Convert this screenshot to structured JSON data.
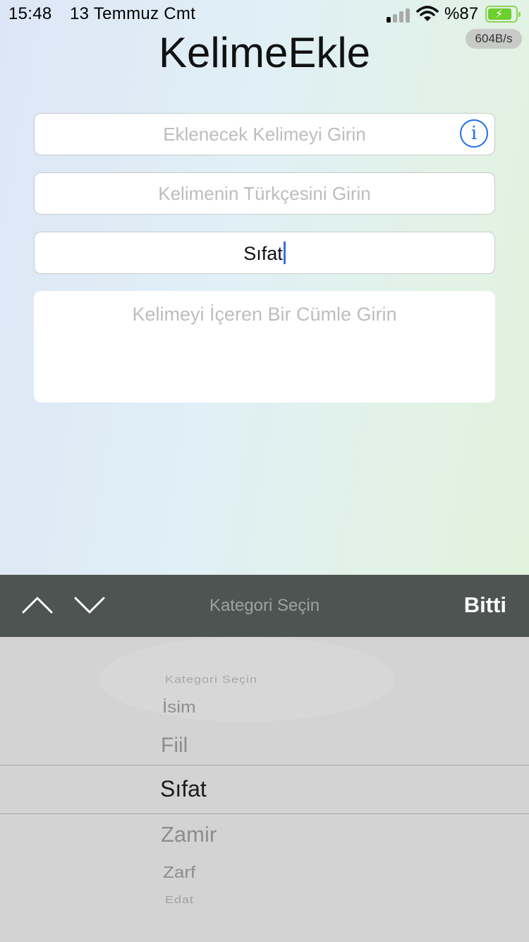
{
  "status_bar": {
    "time": "15:48",
    "date": "13 Temmuz Cmt",
    "battery_percent": "%87",
    "battery_level": 0.87,
    "net_speed": "604B/s",
    "signal_icon": "cellular-signal-icon",
    "wifi_icon": "wifi-icon",
    "battery_icon": "battery-charging-icon"
  },
  "page": {
    "title": "KelimeEkle"
  },
  "form": {
    "word_placeholder": "Eklenecek Kelimeyi Girin",
    "translation_placeholder": "Kelimenin Türkçesini Girin",
    "category_value": "Sıfat",
    "sentence_placeholder": "Kelimeyi İçeren Bir Cümle Girin",
    "info_icon": "info-icon",
    "info_glyph": "i"
  },
  "toolbar": {
    "title": "Kategori Seçin",
    "done_label": "Bitti",
    "prev_icon": "chevron-up-icon",
    "next_icon": "chevron-down-icon"
  },
  "picker": {
    "options": [
      "Kategori Seçin",
      "İsim",
      "Fiil",
      "Sıfat",
      "Zamir",
      "Zarf",
      "Edat"
    ],
    "selected": "Sıfat"
  },
  "colors": {
    "accent": "#1d6fe8",
    "caret": "#3b6fe0",
    "toolbar_bg": "#4e5451",
    "picker_bg": "#d3d3d3",
    "battery_green": "#6bd02d"
  }
}
